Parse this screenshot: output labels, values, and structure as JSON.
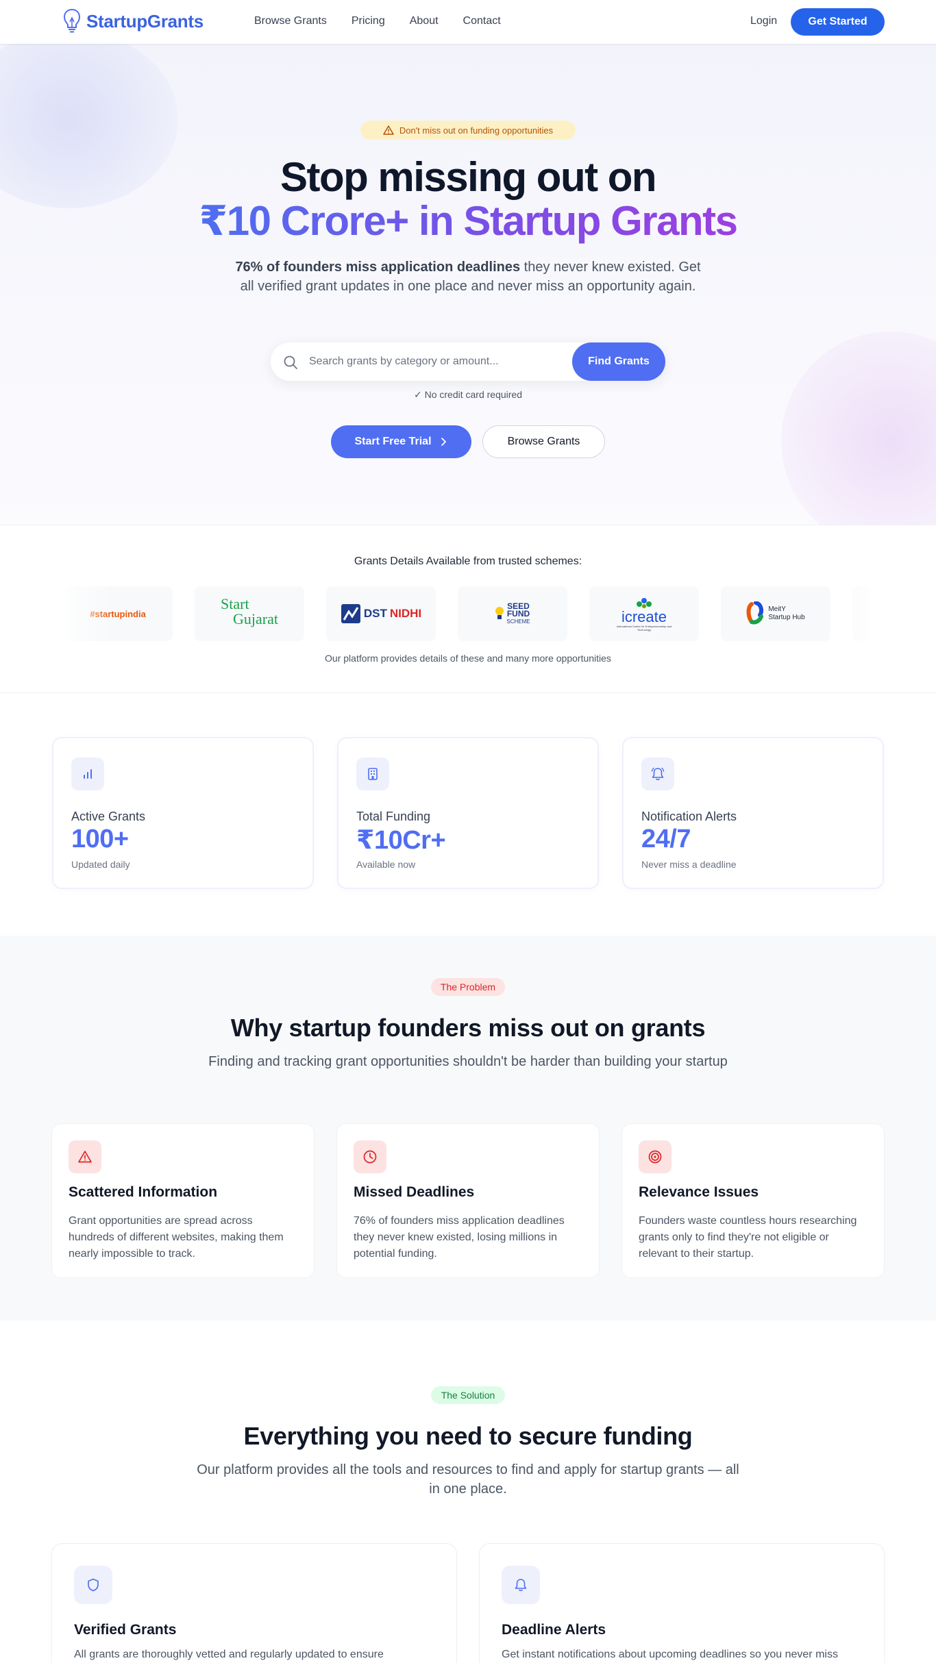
{
  "colors": {
    "primary": "#4f6ef2",
    "nav_cta": "#2563eb",
    "heading": "#0f172a",
    "danger": "#dc2626",
    "success": "#15803d",
    "warning": "#b45309"
  },
  "nav": {
    "brand": "StartupGrants",
    "brand_icon": "lightbulb-icon",
    "links": [
      "Browse Grants",
      "Pricing",
      "About",
      "Contact"
    ],
    "login": "Login",
    "cta": "Get Started"
  },
  "hero": {
    "badge": "Don't miss out on funding opportunities",
    "badge_icon": "warning-triangle-icon",
    "title_line1": "Stop missing out on",
    "title_line2": "₹10 Crore+ in Startup Grants",
    "subtitle_bold": "76% of founders miss application deadlines",
    "subtitle_rest": " they never knew existed. Get all verified grant updates in one place and never miss an opportunity again.",
    "search_placeholder": "Search grants by category or amount...",
    "search_button": "Find Grants",
    "no_credit": "✓ No credit card required",
    "trial_button": "Start Free Trial",
    "browse_button": "Browse Grants"
  },
  "schemes": {
    "title": "Grants Details Available from trusted schemes:",
    "logos": [
      {
        "name": "Startup India",
        "text": "#startupindia"
      },
      {
        "name": "Start Gujarat",
        "line1": "Start",
        "line2": "Gujarat"
      },
      {
        "name": "DST NIDHI",
        "text1": "DST",
        "text2": "NIDHI"
      },
      {
        "name": "Seed Fund Scheme",
        "line1": "SEED",
        "line2": "FUND",
        "line3": "SCHEME"
      },
      {
        "name": "iCreate",
        "text": "icreate",
        "tagline": "International Centre for Entrepreneurship and Technology"
      },
      {
        "name": "MeitY Startup Hub",
        "line1": "MeitY",
        "line2": "Startup Hub"
      }
    ],
    "note": "Our platform provides details of these and many more opportunities"
  },
  "stats": [
    {
      "icon": "bar-chart-icon",
      "label": "Active Grants",
      "value": "100+",
      "note": "Updated daily"
    },
    {
      "icon": "building-icon",
      "label": "Total Funding",
      "value": "₹10Cr+",
      "note": "Available now"
    },
    {
      "icon": "bell-icon",
      "label": "Notification Alerts",
      "value": "24/7",
      "note": "Never miss a deadline"
    }
  ],
  "problem": {
    "badge": "The Problem",
    "title": "Why startup founders miss out on grants",
    "subtitle": "Finding and tracking grant opportunities shouldn't be harder than building your startup",
    "cards": [
      {
        "icon": "alert-triangle-icon",
        "title": "Scattered Information",
        "desc": "Grant opportunities are spread across hundreds of different websites, making them nearly impossible to track."
      },
      {
        "icon": "clock-icon",
        "title": "Missed Deadlines",
        "desc": "76% of founders miss application deadlines they never knew existed, losing millions in potential funding."
      },
      {
        "icon": "target-icon",
        "title": "Relevance Issues",
        "desc": "Founders waste countless hours researching grants only to find they're not eligible or relevant to their startup."
      }
    ]
  },
  "solution": {
    "badge": "The Solution",
    "title": "Everything you need to secure funding",
    "subtitle": "Our platform provides all the tools and resources to find and apply for startup grants — all in one place.",
    "cards": [
      {
        "icon": "shield-icon",
        "title": "Verified Grants",
        "desc": "All grants are thoroughly vetted and regularly updated to ensure"
      },
      {
        "icon": "bell-icon",
        "title": "Deadline Alerts",
        "desc": "Get instant notifications about upcoming deadlines so you never miss"
      }
    ]
  }
}
